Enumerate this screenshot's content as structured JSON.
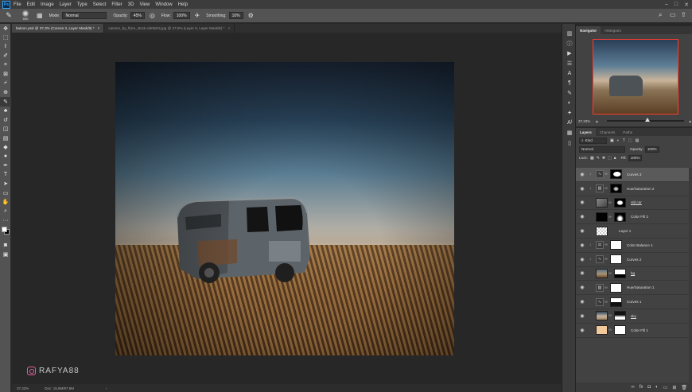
{
  "menu": [
    "File",
    "Edit",
    "Image",
    "Layer",
    "Type",
    "Select",
    "Filter",
    "3D",
    "View",
    "Window",
    "Help"
  ],
  "logo_text": "Ps",
  "options": {
    "brush_size": "500",
    "mode_label": "Mode:",
    "mode_value": "Normal",
    "opacity_label": "Opacity:",
    "opacity_value": "45%",
    "flow_label": "Flow:",
    "flow_value": "100%",
    "smoothing_label": "Smoothing:",
    "smoothing_value": "10%"
  },
  "tabs": [
    {
      "label": "baloon.psd @ 37,3% (Curves 3, Layer Mask/8) *",
      "active": true
    },
    {
      "label": "camion_by_ftore_stock-d40lolzs.jpg @ 27,5% (Layer 0, Layer Mask/8) *",
      "active": false
    }
  ],
  "status": {
    "zoom": "37,33%",
    "doc": "Doc: 15,8M/97,9M"
  },
  "watermark": "RAFYA88",
  "navigator": {
    "tabs": [
      "Navigator",
      "Histogram"
    ],
    "zoom": "37,33%"
  },
  "layers_panel": {
    "tabs": [
      "Layers",
      "Channels",
      "Paths"
    ],
    "kind": "Kind",
    "blend": "Normal",
    "opacity_label": "Opacity:",
    "opacity_value": "100%",
    "lock_label": "Lock:",
    "fill_label": "Fill:",
    "fill_value": "100%",
    "layers": [
      {
        "name": "Curves 3",
        "type": "curves",
        "selected": true,
        "mask": "white-blob",
        "clipped": true
      },
      {
        "name": "Hue/Saturation 2",
        "type": "huesat",
        "selected": false,
        "mask": "dark-blob",
        "clipped": true
      },
      {
        "name": "old car",
        "type": "image",
        "selected": false,
        "mask": "car-mask",
        "clipped": false
      },
      {
        "name": "Color Fill 2",
        "type": "fill",
        "selected": false,
        "mask": "black-shape",
        "clipped": false
      },
      {
        "name": "Layer 1",
        "type": "transparent",
        "selected": false,
        "mask": "",
        "clipped": false
      },
      {
        "name": "Color Balance 1",
        "type": "balance",
        "selected": false,
        "mask": "white",
        "clipped": true
      },
      {
        "name": "Curves 2",
        "type": "curves",
        "selected": false,
        "mask": "white",
        "clipped": true
      },
      {
        "name": "bg",
        "type": "image-bg",
        "selected": false,
        "mask": "white",
        "clipped": false
      },
      {
        "name": "Hue/Saturation 1",
        "type": "huesat",
        "selected": false,
        "mask": "white",
        "clipped": false
      },
      {
        "name": "Curves 1",
        "type": "curves",
        "selected": false,
        "mask": "half",
        "clipped": false
      },
      {
        "name": "sky",
        "type": "image-sky",
        "selected": false,
        "mask": "half2",
        "clipped": false
      },
      {
        "name": "Color Fill 1",
        "type": "peach",
        "selected": false,
        "mask": "white",
        "clipped": false
      }
    ]
  }
}
